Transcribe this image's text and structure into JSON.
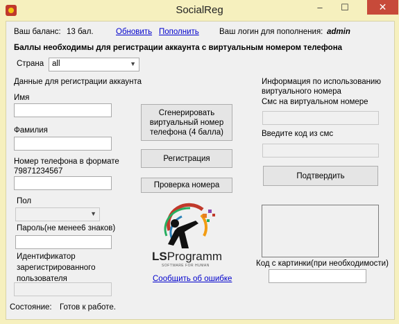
{
  "window": {
    "title": "SocialReg",
    "minimize": "–",
    "maximize": "☐",
    "close": "✕"
  },
  "balance": {
    "label": "Ваш баланс:",
    "value": "13 бал.",
    "refresh_link": "Обновить",
    "topup_link": "Пополнить",
    "login_label": "Ваш логин для пополнения:",
    "login_value": "admin"
  },
  "heading": "Баллы необходимы для регистрации аккаунта с виртуальным номером телефона",
  "country": {
    "label": "Страна",
    "value": "all"
  },
  "account": {
    "section_label": "Данные для регистрации аккаунта",
    "first_name_label": "Имя",
    "first_name_value": "",
    "last_name_label": "Фамилия",
    "last_name_value": "",
    "phone_label": "Номер телефона в формате\n79871234567",
    "phone_value": "",
    "gender_label": "Пол",
    "gender_value": "",
    "password_label": "Пароль(не менее6 знаков)",
    "password_value": "",
    "user_id_label": "Идентификатор\nзарегистрированного\nпользователя",
    "user_id_value": ""
  },
  "actions": {
    "generate_button": "Сгенерировать виртуальный номер телефона (4 балла)",
    "register_button": "Регистрация",
    "check_number_button": "Проверка номера",
    "report_error_link": "Сообщить об ошибке"
  },
  "logo": {
    "brand_ls": "LS",
    "brand_rest": "Programm",
    "tagline": "SOFTWARE FOR HUMAN"
  },
  "virtual": {
    "info_label": "Информация по использованию\nвиртуального номера",
    "sms_label": "Смс на виртуальном номере",
    "sms_value": "",
    "code_label": "Введите код из смс",
    "code_value": "",
    "confirm_button": "Подтвердить",
    "captcha_label": "Код с картинки(при необходимости)",
    "captcha_value": ""
  },
  "status": {
    "label": "Состояние:",
    "value": "Готов к работе."
  }
}
